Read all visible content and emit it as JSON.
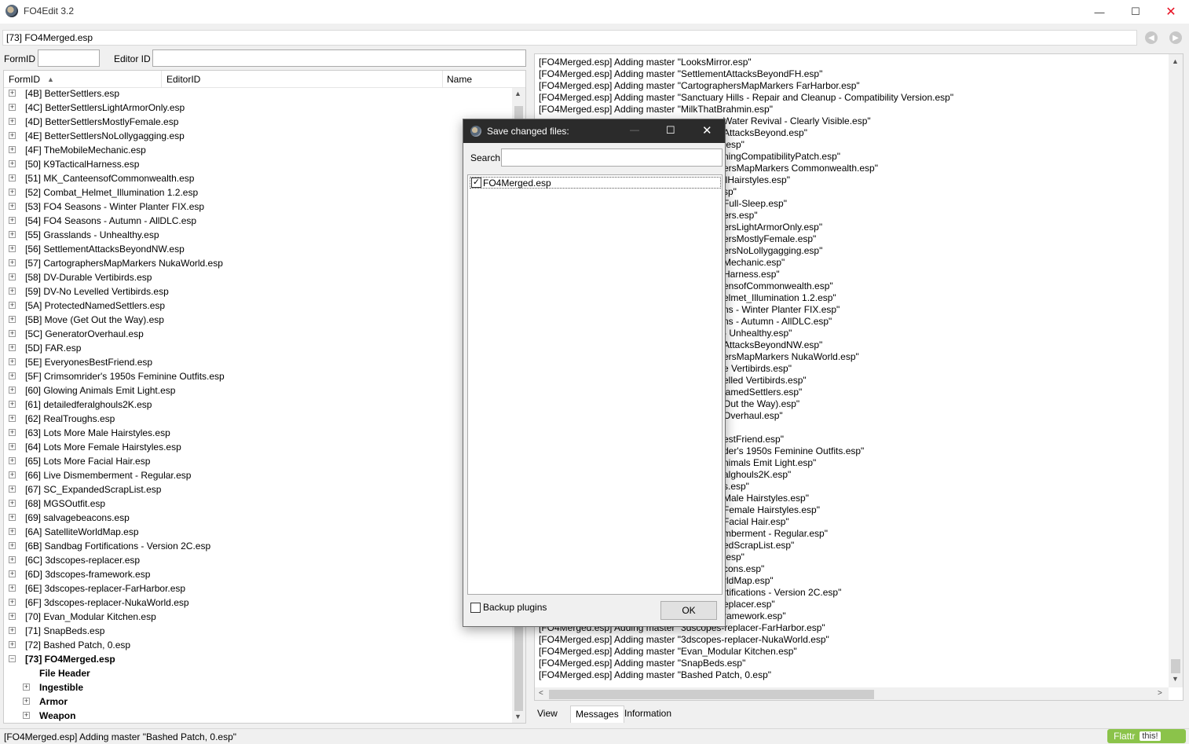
{
  "window": {
    "title": "FO4Edit 3.2",
    "minimize": "—",
    "maximize": "☐",
    "close": "✕"
  },
  "path_bar": {
    "value": "[73] FO4Merged.esp"
  },
  "filters": {
    "formid_label": "FormID",
    "editorid_label": "Editor ID",
    "formid_value": "",
    "editorid_value": ""
  },
  "tree": {
    "headers": {
      "formid": "FormID",
      "sort_indicator": "▲",
      "editorid": "EditorID",
      "name": "Name"
    },
    "rows": [
      "[4B] BetterSettlers.esp",
      "[4C] BetterSettlersLightArmorOnly.esp",
      "[4D] BetterSettlersMostlyFemale.esp",
      "[4E] BetterSettlersNoLollygagging.esp",
      "[4F] TheMobileMechanic.esp",
      "[50] K9TacticalHarness.esp",
      "[51] MK_CanteensofCommonwealth.esp",
      "[52] Combat_Helmet_Illumination 1.2.esp",
      "[53] FO4 Seasons - Winter Planter FIX.esp",
      "[54] FO4 Seasons - Autumn - AllDLC.esp",
      "[55] Grasslands - Unhealthy.esp",
      "[56] SettlementAttacksBeyondNW.esp",
      "[57] CartographersMapMarkers NukaWorld.esp",
      "[58] DV-Durable Vertibirds.esp",
      "[59] DV-No Levelled Vertibirds.esp",
      "[5A] ProtectedNamedSettlers.esp",
      "[5B] Move (Get Out the Way).esp",
      "[5C] GeneratorOverhaul.esp",
      "[5D] FAR.esp",
      "[5E] EveryonesBestFriend.esp",
      "[5F] Crimsomrider's 1950s Feminine Outfits.esp",
      "[60] Glowing Animals Emit Light.esp",
      "[61] detailedferalghouls2K.esp",
      "[62] RealTroughs.esp",
      "[63] Lots More Male Hairstyles.esp",
      "[64] Lots More Female Hairstyles.esp",
      "[65] Lots More Facial Hair.esp",
      "[66] Live Dismemberment - Regular.esp",
      "[67] SC_ExpandedScrapList.esp",
      "[68] MGSOutfit.esp",
      "[69] salvagebeacons.esp",
      "[6A] SatelliteWorldMap.esp",
      "[6B] Sandbag Fortifications - Version 2C.esp",
      "[6C] 3dscopes-replacer.esp",
      "[6D] 3dscopes-framework.esp",
      "[6E] 3dscopes-replacer-FarHarbor.esp",
      "[6F] 3dscopes-replacer-NukaWorld.esp",
      "[70] Evan_Modular Kitchen.esp",
      "[71] SnapBeds.esp",
      "[72] Bashed Patch, 0.esp"
    ],
    "expanded_plugin": "[73] FO4Merged.esp",
    "children": [
      "File Header",
      "Ingestible",
      "Armor",
      "Weapon"
    ]
  },
  "log": {
    "lines": [
      "[FO4Merged.esp] Adding master \"LooksMirror.esp\"",
      "[FO4Merged.esp] Adding master \"SettlementAttacksBeyondFH.esp\"",
      "[FO4Merged.esp] Adding master \"CartographersMapMarkers FarHarbor.esp\"",
      "[FO4Merged.esp] Adding master \"Sanctuary Hills - Repair and Cleanup - Compatibility Version.esp\"",
      "[FO4Merged.esp] Adding master \"MilkThatBrahmin.esp\""
    ],
    "partial_lines": [
      "Water Revival - Clearly Visible.esp\"",
      "AttacksBeyond.esp\"",
      ".esp\"",
      "ningCompatibilityPatch.esp\"",
      "ersMapMarkers Commonwealth.esp\"",
      "ilHairstyles.esp\"",
      "sp\"",
      "Full-Sleep.esp\"",
      "ers.esp\"",
      "ersLightArmorOnly.esp\"",
      "ersMostlyFemale.esp\"",
      "ersNoLollygagging.esp\"",
      "Mechanic.esp\"",
      "Harness.esp\"",
      "ensofCommonwealth.esp\"",
      "elmet_Illumination 1.2.esp\"",
      "ns - Winter Planter FIX.esp\"",
      "ns - Autumn - AllDLC.esp\"",
      "- Unhealthy.esp\"",
      "AttacksBeyondNW.esp\"",
      "ersMapMarkers NukaWorld.esp\"",
      "e Vertibirds.esp\"",
      "elled Vertibirds.esp\"",
      "lamedSettlers.esp\"",
      "Out the Way).esp\"",
      "Overhaul.esp\"",
      "",
      "estFriend.esp\"",
      "der's 1950s Feminine Outfits.esp\"",
      "nimals Emit Light.esp\"",
      "alghouls2K.esp\"",
      "s.esp\"",
      "Male Hairstyles.esp\"",
      "Female Hairstyles.esp\"",
      "Facial Hair.esp\"",
      "mberment - Regular.esp\"",
      "edScrapList.esp\"",
      ".esp\"",
      "cons.esp\"",
      "rldMap.esp\"",
      "rtifications - Version 2C.esp\"",
      "eplacer.esp\"",
      "ramework.esp\""
    ],
    "tail_lines": [
      "[FO4Merged.esp] Adding master \"3dscopes-replacer-FarHarbor.esp\"",
      "[FO4Merged.esp] Adding master \"3dscopes-replacer-NukaWorld.esp\"",
      "[FO4Merged.esp] Adding master \"Evan_Modular Kitchen.esp\"",
      "[FO4Merged.esp] Adding master \"SnapBeds.esp\"",
      "[FO4Merged.esp] Adding master \"Bashed Patch, 0.esp\""
    ]
  },
  "tabs": [
    "View",
    "Messages",
    "Information"
  ],
  "status": {
    "text": "[FO4Merged.esp] Adding master \"Bashed Patch, 0.esp\"",
    "flattr": "Flattr",
    "flattr_this": "this!"
  },
  "dialog": {
    "title": "Save changed files:",
    "search_label": "Search",
    "search_value": "",
    "files": [
      {
        "name": "FO4Merged.esp",
        "checked": true
      }
    ],
    "backup_label": "Backup plugins",
    "ok_label": "OK",
    "check_mark": "✓"
  }
}
